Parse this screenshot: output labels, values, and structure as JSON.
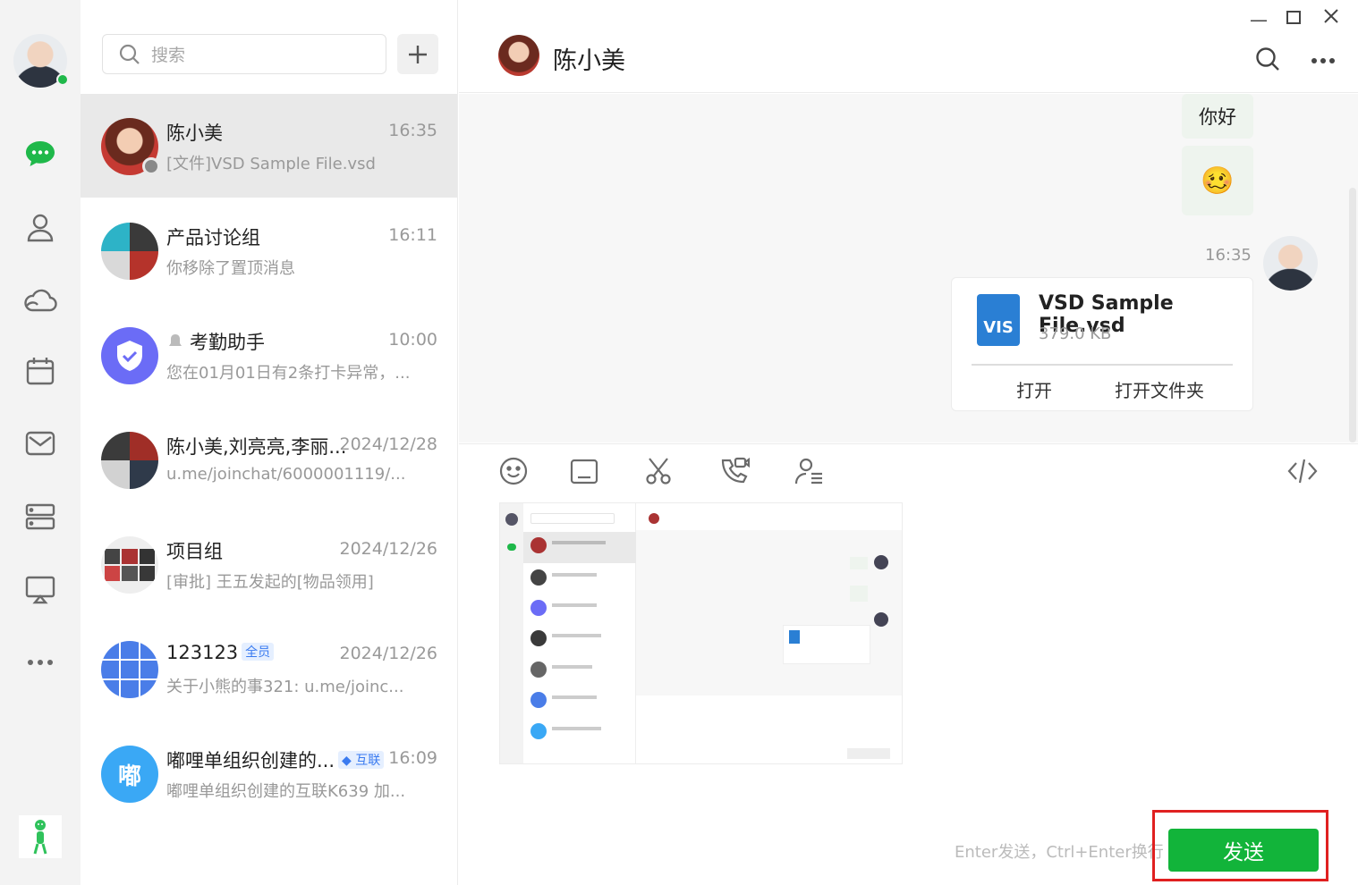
{
  "sidebar": {
    "nav_icons": [
      "chat-icon",
      "contacts-icon",
      "cloud-icon",
      "calendar-icon",
      "mail-icon",
      "workbench-icon",
      "screen-share-icon",
      "more-icon"
    ]
  },
  "search": {
    "placeholder": "搜索"
  },
  "conversations": [
    {
      "name": "陈小美",
      "time": "16:35",
      "preview": "[文件]VSD Sample File.vsd",
      "active": true
    },
    {
      "name": "产品讨论组",
      "time": "16:11",
      "preview": "你移除了置顶消息"
    },
    {
      "name": "考勤助手",
      "time": "10:00",
      "preview": "您在01月01日有2条打卡异常，..."
    },
    {
      "name": "陈小美,刘亮亮,李丽...",
      "time": "2024/12/28",
      "preview": "u.me/joinchat/6000001119/..."
    },
    {
      "name": "项目组",
      "time": "2024/12/26",
      "preview": "[审批] 王五发起的[物品领用]"
    },
    {
      "name": "123123",
      "tag": "全员",
      "time": "2024/12/26",
      "preview": "关于小熊的事321: u.me/joinc..."
    },
    {
      "name": "嘟哩单组织创建的...",
      "tag": "互联",
      "time": "16:09",
      "preview": "嘟哩单组织创建的互联K639 加...",
      "avatar_text": "嘟"
    }
  ],
  "chat": {
    "title": "陈小美",
    "messages": [
      {
        "type": "text",
        "text": "你好"
      },
      {
        "type": "emoji",
        "emoji": "🥴"
      }
    ],
    "timestamp": "16:35",
    "file": {
      "name": "VSD Sample File.vsd",
      "size": "379.0 KB",
      "icon_text": "VIS",
      "open_label": "打开",
      "open_folder_label": "打开文件夹"
    }
  },
  "composer": {
    "hint": "Enter发送，Ctrl+Enter换行",
    "send_label": "发送"
  },
  "colors": {
    "accent": "#12b43a",
    "highlight": "#e02020"
  }
}
